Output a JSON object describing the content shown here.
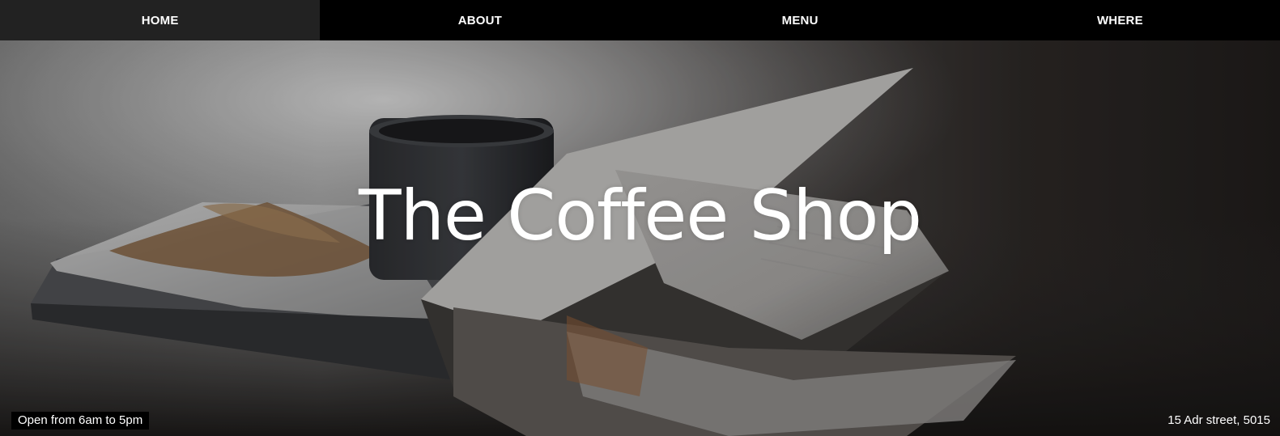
{
  "nav": {
    "items": [
      {
        "label": "HOME"
      },
      {
        "label": "ABOUT"
      },
      {
        "label": "MENU"
      },
      {
        "label": "WHERE"
      }
    ]
  },
  "hero": {
    "title": "The Coffee Shop",
    "hours": "Open from 6am to 5pm",
    "address": "15 Adr street, 5015",
    "image_subject": "coffee-cup-and-open-book-photo"
  },
  "colors": {
    "nav_bg": "#000000",
    "nav_text": "#ffffff",
    "hero_text": "#ffffff",
    "badge_bg": "#000000"
  }
}
